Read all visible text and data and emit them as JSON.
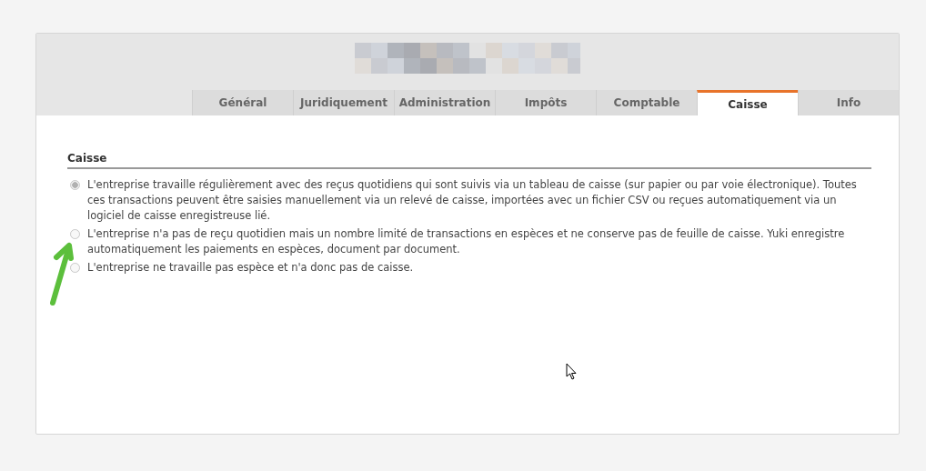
{
  "tabs": [
    {
      "label": "Général",
      "selected": false
    },
    {
      "label": "Juridiquement",
      "selected": false
    },
    {
      "label": "Administration",
      "selected": false
    },
    {
      "label": "Impôts",
      "selected": false
    },
    {
      "label": "Comptable",
      "selected": false
    },
    {
      "label": "Caisse",
      "selected": true
    },
    {
      "label": "Info",
      "selected": false
    }
  ],
  "section": {
    "title": "Caisse",
    "options": [
      {
        "label": "L'entreprise travaille régulièrement avec des reçus quotidiens qui sont suivis via un tableau de caisse (sur papier ou par voie électronique). Toutes ces transactions peuvent être saisies manuellement via un relevé de caisse, importées avec un fichier CSV ou reçues automatiquement via un logiciel de caisse enregistreuse lié.",
        "selected": true
      },
      {
        "label": "L'entreprise n'a pas de reçu quotidien mais un nombre limité de transactions en espèces et ne conserve pas de feuille de caisse. Yuki enregistre automatiquement les paiements en espèces, document par document.",
        "selected": false
      },
      {
        "label": "L'entreprise ne travaille pas espèce et n'a donc pas de caisse.",
        "selected": false
      }
    ]
  }
}
